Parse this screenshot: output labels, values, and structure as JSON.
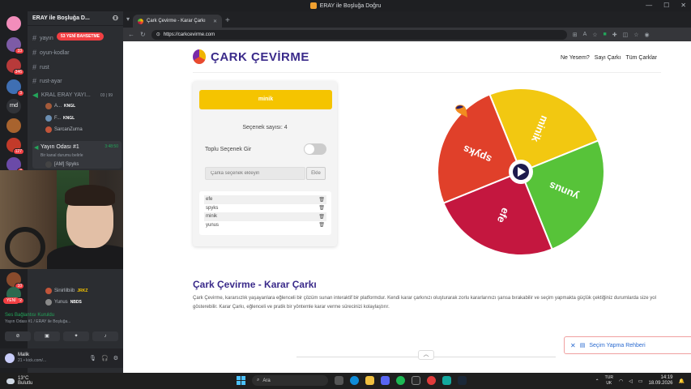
{
  "os": {
    "window_title": "ERAY ile Boşluğa Doğru"
  },
  "discord": {
    "server_name": "ERAY ile Boşluğa D...",
    "new_badge": "53 YENİ BAHSETME",
    "channels": [
      "yayın",
      "oyun-kodlar",
      "rust",
      "rust-ayar"
    ],
    "voice_channel": "KRAL ERAY YAYI...",
    "voice_channel_counts": "03 | 99",
    "members_top": [
      "A...",
      "F...",
      "SarcanZurna"
    ],
    "member_tags": [
      "KNGL",
      "KNGL"
    ],
    "stream_room": {
      "title": "Yayın Odası #1",
      "time": "3:48:50",
      "sub": "Bir kanal durumu belirle"
    },
    "stream_member": "[AM] Spyks",
    "members_bottom": [
      "Sinirlilbiib",
      "Yunus"
    ],
    "member_bottom_tags": [
      "JRKZ",
      "NBDS"
    ],
    "yeni_badge": "YENİ",
    "server_badges": [
      "33",
      "346",
      "3",
      "127",
      "3",
      "10",
      "82"
    ],
    "voice_status": {
      "title": "Ses Bağlantısı Kuruldu",
      "sub": "Yayın Odası #1 / ERAY ile Boşluğa..."
    },
    "user": {
      "name": "Malik",
      "status": "21 • kick.com/..."
    }
  },
  "browser": {
    "tab_title": "Çark Çevirme - Karar Çarkı",
    "url": "https://carkcevirme.com"
  },
  "site": {
    "logo": "ÇARK ÇEVİRME",
    "nav": [
      "Ne Yesem?",
      "Sayı Çarkı",
      "Tüm Çarklar"
    ],
    "spin_button": "minik",
    "option_count": "Seçenek sayısı: 4",
    "bulk_label": "Toplu Seçenek Gir",
    "bulk_enabled": false,
    "input_placeholder": "Çarka seçenek ekleyin",
    "add_button": "Ekle",
    "options": [
      "efe",
      "spyks",
      "minik",
      "yunus"
    ],
    "delete_icon": "trash-icon",
    "wheel": {
      "segments": [
        {
          "label": "minik",
          "color": "#f2c811"
        },
        {
          "label": "yunus",
          "color": "#57c339"
        },
        {
          "label": "efe",
          "color": "#c4173f"
        },
        {
          "label": "spyks",
          "color": "#e0402a"
        }
      ],
      "center_icon": "play-icon"
    },
    "heading": "Çark Çevirme - Karar Çarkı",
    "paragraph": "Çark Çevirme, kararsızlık yaşayanlara eğlenceli bir çözüm sunan interaktif bir platformdur. Kendi karar çarkınızı oluşturarak zorlu kararlarınızı şansa bırakabilir ve seçim yapmakta güçlük çektiğiniz durumlarda size yol gösterebilir. Karar Çarkı, eğlenceli ve pratik bir yöntemle karar verme sürecinizi kolaylaştırır.",
    "guide_button": "Seçim Yapma Rehberi"
  },
  "taskbar": {
    "weather_temp": "13°C",
    "weather_desc": "Bulutlu",
    "search_label": "Ara",
    "lang": "TUR",
    "lang_sub": "UK",
    "time": "14:19",
    "date": "18.09.2026"
  }
}
